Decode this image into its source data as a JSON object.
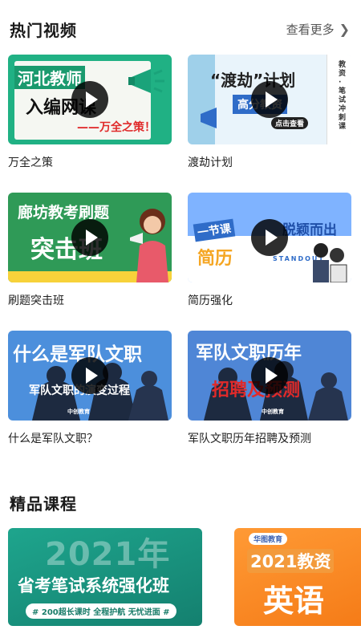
{
  "hot_videos": {
    "title": "热门视频",
    "more_label": "查看更多",
    "items": [
      {
        "caption": "万全之策",
        "thumb_lines": [
          "河北教师",
          "入编网课",
          "——万全之策！"
        ]
      },
      {
        "caption": "渡劫计划",
        "thumb_lines": [
          "“渡劫”计划",
          "高分教资",
          "点击查看",
          "教资·笔试冲刺课"
        ]
      },
      {
        "caption": "刷题突击班",
        "thumb_lines": [
          "廊坊教考刷题",
          "突击班"
        ]
      },
      {
        "caption": "简历强化",
        "thumb_lines": [
          "一节课",
          "脱颖而出",
          "简历",
          "STANDOUT"
        ]
      },
      {
        "caption": "什么是军队文职？",
        "thumb_lines": [
          "什么是军队文职",
          "军队文职的演变过程",
          "中创教育"
        ]
      },
      {
        "caption": "军队文职历年招聘及预测",
        "thumb_lines": [
          "军队文职历年",
          "招聘及预测",
          "中创教育"
        ]
      }
    ]
  },
  "courses": {
    "title": "精品课程",
    "items": [
      {
        "lines": [
          "2021年",
          "省考笔试系统强化班",
          "# 200超长课时 全程护航 无忧进面 #"
        ]
      },
      {
        "lines": [
          "华图教育",
          "2021教资",
          "英语"
        ]
      }
    ]
  },
  "colors": {
    "accent_red": "#e02a2a",
    "green": "#20b184",
    "blue": "#4c8fdc",
    "orange": "#f57b17"
  }
}
